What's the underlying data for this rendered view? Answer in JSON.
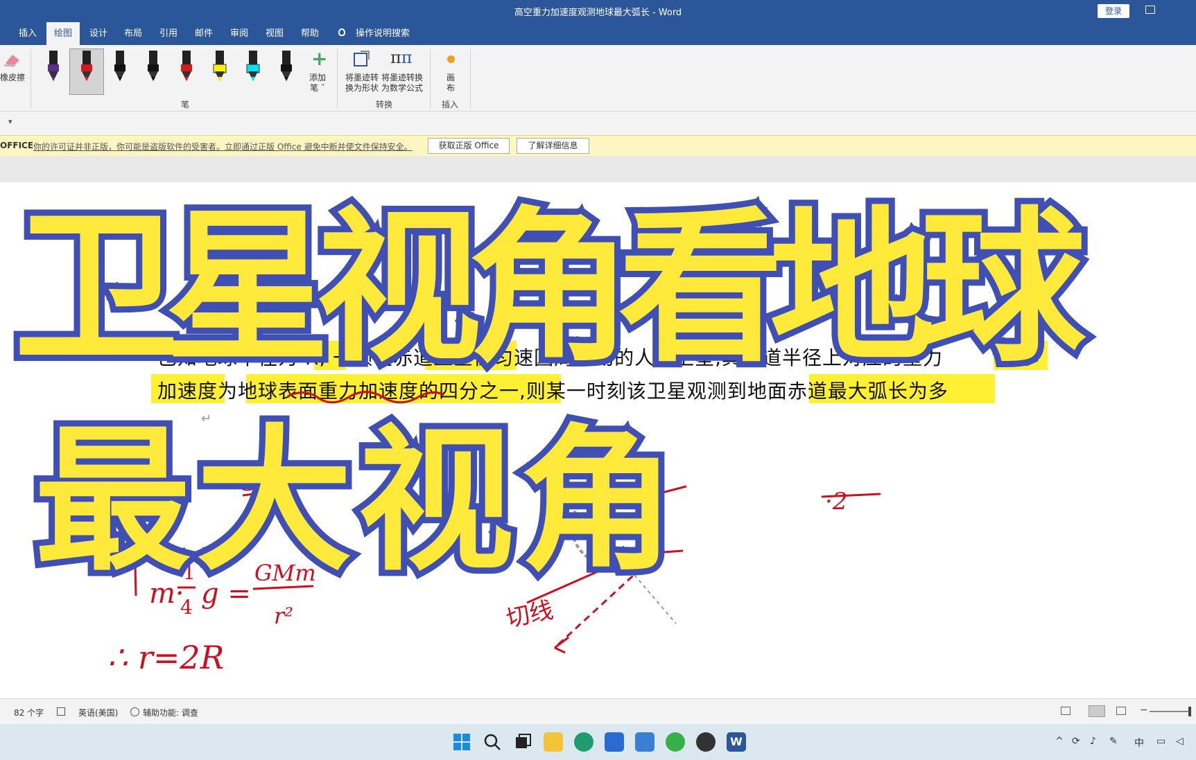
{
  "window": {
    "title": "高空重力加速度观测地球最大弧长  -  Word",
    "login": "登录"
  },
  "tabs": [
    {
      "label": "插入"
    },
    {
      "label": "绘图"
    },
    {
      "label": "设计"
    },
    {
      "label": "布局"
    },
    {
      "label": "引用"
    },
    {
      "label": "邮件"
    },
    {
      "label": "审阅"
    },
    {
      "label": "视图"
    },
    {
      "label": "帮助"
    }
  ],
  "tab_search": "操作说明搜索",
  "ribbon": {
    "eraser_label": "橡皮擦",
    "add_pen_label_1": "添加",
    "add_pen_label_2": "笔 ˇ",
    "pen_group_label": "笔",
    "convert_shape_1": "将墨迹转",
    "convert_shape_2": "换为形状",
    "convert_math_1": "将墨迹转换",
    "convert_math_2": "为数学公式",
    "convert_group_label": "转换",
    "canvas_1": "画",
    "canvas_2": "布",
    "insert_group_label": "插入",
    "pen_colors": [
      "#5b2d8e",
      "#d7191c",
      "#111111",
      "#111111",
      "#d7191c",
      "#fff200",
      "#00e5ee",
      "#111111"
    ]
  },
  "warning": {
    "office": "OFFICE",
    "message": "你的许可证并非正版，你可能是盗版软件的受害者。立即通过正版 Office 避免中断并使文件保持安全。",
    "get_genuine": "获取正版 Office",
    "learn_more": "了解详细信息"
  },
  "document": {
    "line1": "已知地球半径为 R, 一颗在赤道上空做匀速圆周运动的人造卫星,其轨道半径上对应的重力",
    "line2": "加速度为地球表面重力加速度的四分之一,则某一时刻该卫星观测到地面赤道最大弧长为多"
  },
  "overlay": {
    "title1": "卫星视角看地球",
    "title2": "最大视角"
  },
  "ink": {
    "eq": "m·¼g = GMm/r²",
    "eq_lhs": "m·",
    "eq_rhs_top": "GMm",
    "eq_rhs_bottom": "r²",
    "frac_top": "1",
    "frac_bottom": "4",
    "eq_g": "g =",
    "result": "∴ r=2R",
    "tangent": "切线",
    "left_partial": "G",
    "right_partial": "·2"
  },
  "status": {
    "word_count": "82 个字",
    "language": "英语(美国)",
    "accessibility": "辅助功能: 调查"
  },
  "colors": {
    "title_bar": "#2b579a",
    "highlight": "#fff033",
    "ink": "#cc1020",
    "big_fill": "#ffe93a",
    "big_stroke": "#3f4fb3"
  }
}
